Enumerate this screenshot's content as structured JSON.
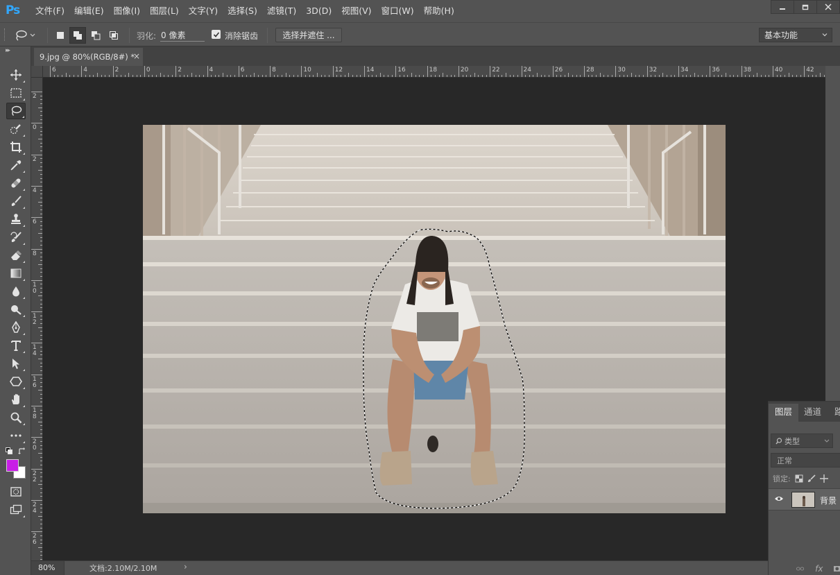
{
  "app": {
    "logo": "Ps",
    "menu": [
      "文件(F)",
      "编辑(E)",
      "图像(I)",
      "图层(L)",
      "文字(Y)",
      "选择(S)",
      "滤镜(T)",
      "3D(D)",
      "视图(V)",
      "窗口(W)",
      "帮助(H)"
    ],
    "window_controls": [
      "minimize-icon",
      "restore-icon",
      "close-icon"
    ]
  },
  "options": {
    "feather_label": "羽化:",
    "feather_value": "0 像素",
    "antialias_label": "消除锯齿",
    "antialias_checked": true,
    "select_mask_button": "选择并遮住 ...",
    "workspace": "基本功能"
  },
  "document": {
    "tab_title": "9.jpg @ 80%(RGB/8#) *",
    "tab_close": "×"
  },
  "rulers": {
    "horizontal": [
      "6",
      "4",
      "2",
      "0",
      "2",
      "4",
      "6",
      "8",
      "10",
      "12",
      "14",
      "16",
      "18",
      "20",
      "22",
      "24",
      "26",
      "28",
      "30",
      "32",
      "34",
      "36",
      "38",
      "40",
      "42"
    ],
    "vertical": [
      "2",
      "0",
      "2",
      "4",
      "6",
      "8",
      "1\n0",
      "1\n2",
      "1\n4",
      "1\n6",
      "1\n8",
      "2\n0",
      "2\n2",
      "2\n4",
      "2\n6"
    ]
  },
  "tools": [
    {
      "name": "move-tool",
      "icon": "move-icon"
    },
    {
      "name": "marquee-tool",
      "icon": "marquee-icon"
    },
    {
      "name": "lasso-tool",
      "icon": "lasso-icon",
      "active": true
    },
    {
      "name": "quick-select-tool",
      "icon": "quick-select-icon"
    },
    {
      "name": "crop-tool",
      "icon": "crop-icon"
    },
    {
      "name": "eyedropper-tool",
      "icon": "eyedropper-icon"
    },
    {
      "name": "healing-brush-tool",
      "icon": "bandage-icon"
    },
    {
      "name": "brush-tool",
      "icon": "brush-icon"
    },
    {
      "name": "clone-stamp-tool",
      "icon": "stamp-icon"
    },
    {
      "name": "history-brush-tool",
      "icon": "history-brush-icon"
    },
    {
      "name": "eraser-tool",
      "icon": "eraser-icon"
    },
    {
      "name": "gradient-tool",
      "icon": "gradient-icon"
    },
    {
      "name": "blur-tool",
      "icon": "drop-icon"
    },
    {
      "name": "dodge-tool",
      "icon": "dodge-icon"
    },
    {
      "name": "pen-tool",
      "icon": "pen-icon"
    },
    {
      "name": "type-tool",
      "icon": "type-icon"
    },
    {
      "name": "path-select-tool",
      "icon": "arrow-icon"
    },
    {
      "name": "shape-tool",
      "icon": "hexagon-icon"
    },
    {
      "name": "hand-tool",
      "icon": "hand-icon"
    },
    {
      "name": "zoom-tool",
      "icon": "zoom-icon"
    },
    {
      "name": "more-tools",
      "icon": "ellipsis-icon"
    }
  ],
  "colors": {
    "foreground": "#c81ee6",
    "background": "#ffffff",
    "canvas_bg": "#282828",
    "ui_bg": "#535353"
  },
  "status": {
    "zoom": "80%",
    "doc_info": "文档:2.10M/2.10M",
    "arrow": "›"
  },
  "layers_panel": {
    "tabs": [
      "图层",
      "通道",
      "路"
    ],
    "filter_placeholder": "类型",
    "blend_mode": "正常",
    "lock_label": "锁定:",
    "layer_name": "背景",
    "footer_fx": "fx"
  }
}
